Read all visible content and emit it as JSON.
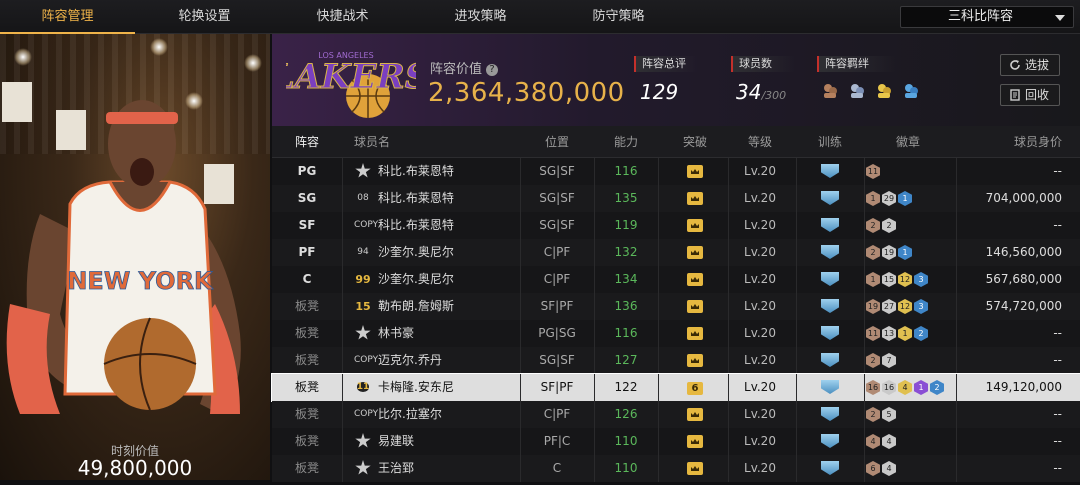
{
  "nav": {
    "tabs": [
      "阵容管理",
      "轮换设置",
      "快捷战术",
      "进攻策略",
      "防守策略"
    ],
    "active_index": 0,
    "team_select": "三科比阵容"
  },
  "player_card": {
    "jersey_text": "NEW YORK",
    "value_label": "时刻价值",
    "value": "49,800,000"
  },
  "header": {
    "team_logo_text": "LAKERS",
    "team_logo_subtext": "LOS ANGELES",
    "lineup_value_label": "阵容价值",
    "lineup_value": "2,364,380,000",
    "overall_label": "阵容总评",
    "overall_value": "129",
    "player_count_label": "球员数",
    "player_count_value": "34",
    "player_count_max": "/300",
    "bond_label": "阵容羁绊",
    "btn_select": "选拔",
    "btn_recycle": "回收"
  },
  "columns": [
    "阵容",
    "球员名",
    "位置",
    "能力",
    "突破",
    "等级",
    "训练",
    "徽章",
    "球员身价"
  ],
  "rows": [
    {
      "slot": "PG",
      "badge": "star",
      "name": "科比.布莱恩特",
      "pos": "SG|SF",
      "power": "116",
      "break": "",
      "level": "Lv.20",
      "emblems": [
        {
          "c": "bronze",
          "t": "11"
        }
      ],
      "value": "--"
    },
    {
      "slot": "SG",
      "badge": "08",
      "name": "科比.布莱恩特",
      "pos": "SG|SF",
      "power": "135",
      "break": "",
      "level": "Lv.20",
      "emblems": [
        {
          "c": "bronze",
          "t": "1"
        },
        {
          "c": "silver",
          "t": "29"
        },
        {
          "c": "blue",
          "t": "1"
        }
      ],
      "value": "704,000,000"
    },
    {
      "slot": "SF",
      "badge": "COPY",
      "name": "科比.布莱恩特",
      "pos": "SG|SF",
      "power": "119",
      "break": "",
      "level": "Lv.20",
      "emblems": [
        {
          "c": "bronze",
          "t": "2"
        },
        {
          "c": "silver",
          "t": "2"
        }
      ],
      "value": "--"
    },
    {
      "slot": "PF",
      "badge": "94",
      "name": "沙奎尔.奥尼尔",
      "pos": "C|PF",
      "power": "132",
      "break": "",
      "level": "Lv.20",
      "emblems": [
        {
          "c": "bronze",
          "t": "2"
        },
        {
          "c": "silver",
          "t": "19"
        },
        {
          "c": "blue",
          "t": "1"
        }
      ],
      "value": "146,560,000"
    },
    {
      "slot": "C",
      "badge": "99",
      "name": "沙奎尔.奥尼尔",
      "pos": "C|PF",
      "power": "134",
      "break": "",
      "level": "Lv.20",
      "emblems": [
        {
          "c": "bronze",
          "t": "1"
        },
        {
          "c": "silver",
          "t": "15"
        },
        {
          "c": "gold",
          "t": "12"
        },
        {
          "c": "blue",
          "t": "3"
        }
      ],
      "value": "567,680,000"
    },
    {
      "slot": "板凳",
      "badge": "15",
      "name": "勒布朗.詹姆斯",
      "pos": "SF|PF",
      "power": "136",
      "break": "",
      "level": "Lv.20",
      "emblems": [
        {
          "c": "bronze",
          "t": "19"
        },
        {
          "c": "silver",
          "t": "27"
        },
        {
          "c": "gold",
          "t": "12"
        },
        {
          "c": "blue",
          "t": "3"
        }
      ],
      "value": "574,720,000"
    },
    {
      "slot": "板凳",
      "badge": "star",
      "name": "林书豪",
      "pos": "PG|SG",
      "power": "116",
      "break": "",
      "level": "Lv.20",
      "emblems": [
        {
          "c": "bronze",
          "t": "11"
        },
        {
          "c": "silver",
          "t": "13"
        },
        {
          "c": "gold",
          "t": "1"
        },
        {
          "c": "blue",
          "t": "2"
        }
      ],
      "value": "--"
    },
    {
      "slot": "板凳",
      "badge": "COPY",
      "name": "迈克尔.乔丹",
      "pos": "SG|SF",
      "power": "127",
      "break": "",
      "level": "Lv.20",
      "emblems": [
        {
          "c": "bronze",
          "t": "2"
        },
        {
          "c": "silver",
          "t": "7"
        }
      ],
      "value": "--"
    },
    {
      "slot": "板凳",
      "badge": "11",
      "name": "卡梅隆.安东尼",
      "pos": "SF|PF",
      "power": "122",
      "break": "6",
      "level": "Lv.20",
      "emblems": [
        {
          "c": "bronze",
          "t": "16"
        },
        {
          "c": "silver",
          "t": "16"
        },
        {
          "c": "gold",
          "t": "4"
        },
        {
          "c": "purple",
          "t": "1"
        },
        {
          "c": "blue",
          "t": "2"
        }
      ],
      "value": "149,120,000",
      "selected": true
    },
    {
      "slot": "板凳",
      "badge": "COPY",
      "name": "比尔.拉塞尔",
      "pos": "C|PF",
      "power": "126",
      "break": "",
      "level": "Lv.20",
      "emblems": [
        {
          "c": "bronze",
          "t": "2"
        },
        {
          "c": "silver",
          "t": "5"
        }
      ],
      "value": "--"
    },
    {
      "slot": "板凳",
      "badge": "star",
      "name": "易建联",
      "pos": "PF|C",
      "power": "110",
      "break": "",
      "level": "Lv.20",
      "emblems": [
        {
          "c": "bronze",
          "t": "4"
        },
        {
          "c": "silver",
          "t": "4"
        }
      ],
      "value": "--"
    },
    {
      "slot": "板凳",
      "badge": "star",
      "name": "王治郅",
      "pos": "C",
      "power": "110",
      "break": "",
      "level": "Lv.20",
      "emblems": [
        {
          "c": "bronze",
          "t": "6"
        },
        {
          "c": "silver",
          "t": "4"
        }
      ],
      "value": "--"
    }
  ],
  "colors": {
    "accent": "#f0b44a",
    "power": "#5bb85b",
    "selected_row": "#dedede"
  }
}
